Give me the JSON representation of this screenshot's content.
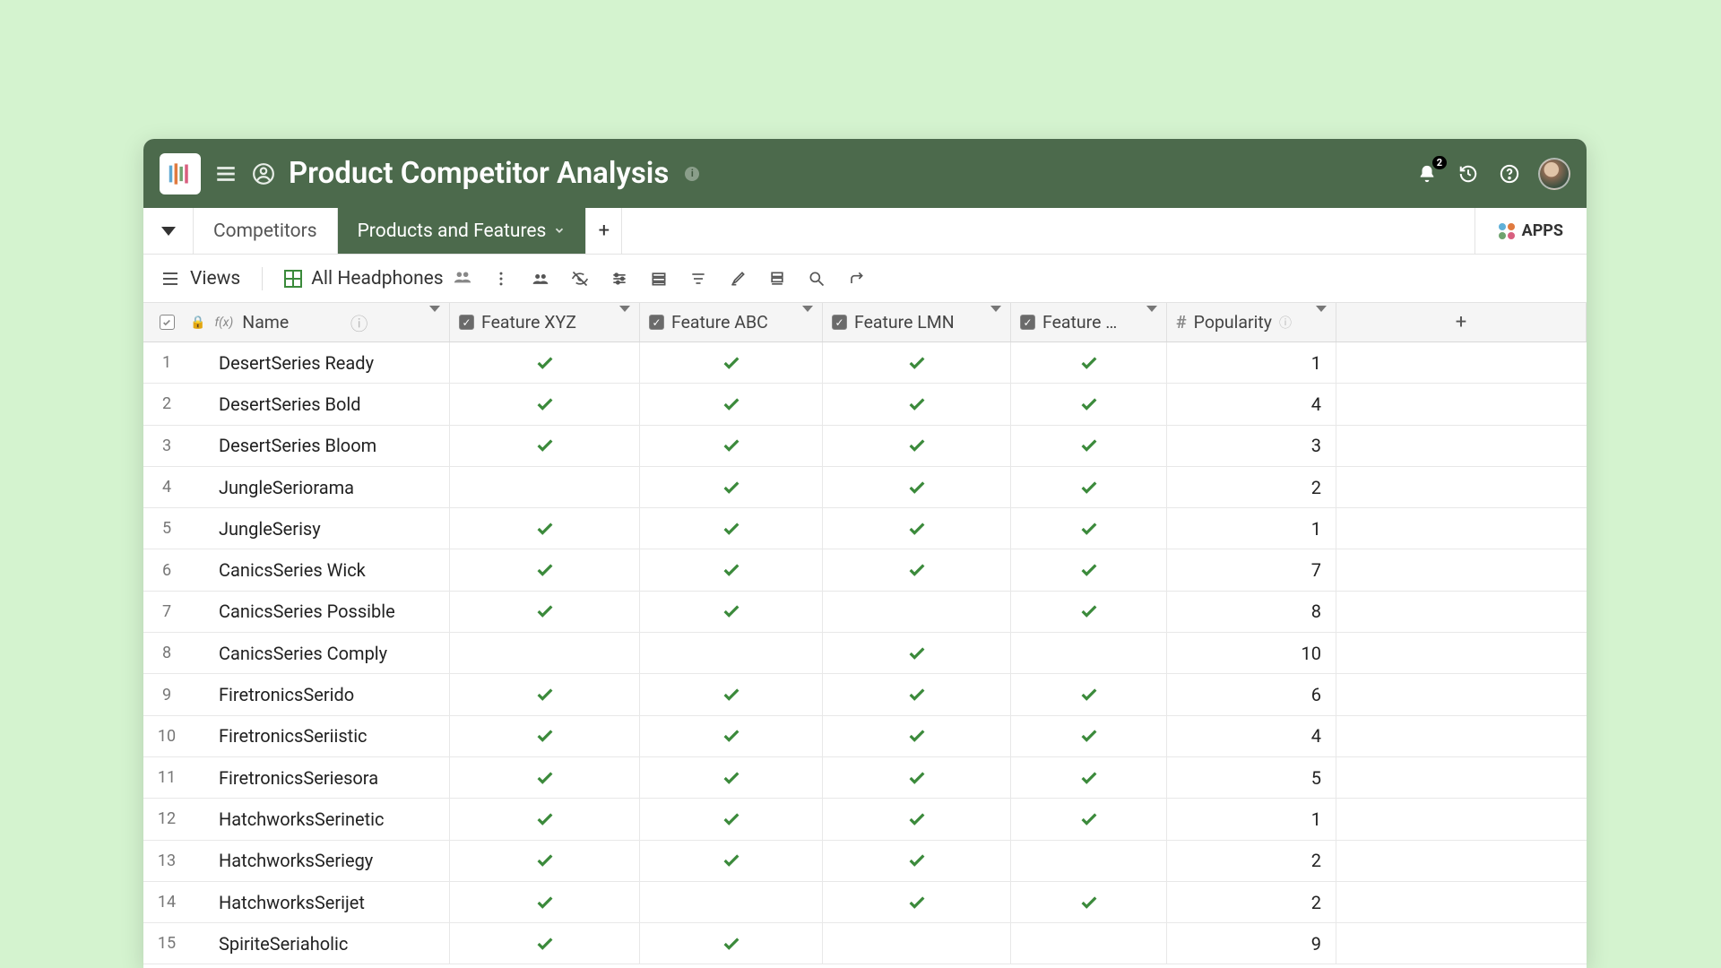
{
  "header": {
    "title": "Product Competitor Analysis",
    "notification_count": "2"
  },
  "tabs": {
    "items": [
      "Competitors",
      "Products and Features"
    ],
    "active_index": 1,
    "apps_label": "APPS"
  },
  "toolbar": {
    "views_label": "Views",
    "view_name": "All Headphones"
  },
  "columns": {
    "name": "Name",
    "feature_xyz": "Feature XYZ",
    "feature_abc": "Feature ABC",
    "feature_lmn": "Feature LMN",
    "feature_trunc": "Feature …",
    "popularity": "Popularity"
  },
  "rows": [
    {
      "n": "1",
      "name": "DesertSeries Ready",
      "xyz": true,
      "abc": true,
      "lmn": true,
      "f4": true,
      "pop": "1"
    },
    {
      "n": "2",
      "name": "DesertSeries Bold",
      "xyz": true,
      "abc": true,
      "lmn": true,
      "f4": true,
      "pop": "4"
    },
    {
      "n": "3",
      "name": "DesertSeries Bloom",
      "xyz": true,
      "abc": true,
      "lmn": true,
      "f4": true,
      "pop": "3"
    },
    {
      "n": "4",
      "name": "JungleSeriorama",
      "xyz": false,
      "abc": true,
      "lmn": true,
      "f4": true,
      "pop": "2"
    },
    {
      "n": "5",
      "name": "JungleSerisy",
      "xyz": true,
      "abc": true,
      "lmn": true,
      "f4": true,
      "pop": "1"
    },
    {
      "n": "6",
      "name": "CanicsSeries Wick",
      "xyz": true,
      "abc": true,
      "lmn": true,
      "f4": true,
      "pop": "7"
    },
    {
      "n": "7",
      "name": "CanicsSeries Possible",
      "xyz": true,
      "abc": true,
      "lmn": false,
      "f4": true,
      "pop": "8"
    },
    {
      "n": "8",
      "name": "CanicsSeries Comply",
      "xyz": false,
      "abc": false,
      "lmn": true,
      "f4": false,
      "pop": "10"
    },
    {
      "n": "9",
      "name": "FiretronicsSerido",
      "xyz": true,
      "abc": true,
      "lmn": true,
      "f4": true,
      "pop": "6"
    },
    {
      "n": "10",
      "name": "FiretronicsSeriistic",
      "xyz": true,
      "abc": true,
      "lmn": true,
      "f4": true,
      "pop": "4"
    },
    {
      "n": "11",
      "name": "FiretronicsSeriesora",
      "xyz": true,
      "abc": true,
      "lmn": true,
      "f4": true,
      "pop": "5"
    },
    {
      "n": "12",
      "name": "HatchworksSerinetic",
      "xyz": true,
      "abc": true,
      "lmn": true,
      "f4": true,
      "pop": "1"
    },
    {
      "n": "13",
      "name": "HatchworksSeriegy",
      "xyz": true,
      "abc": true,
      "lmn": true,
      "f4": false,
      "pop": "2"
    },
    {
      "n": "14",
      "name": "HatchworksSerijet",
      "xyz": true,
      "abc": false,
      "lmn": true,
      "f4": true,
      "pop": "2"
    },
    {
      "n": "15",
      "name": "SpiriteSeriaholic",
      "xyz": true,
      "abc": true,
      "lmn": false,
      "f4": false,
      "pop": "9"
    }
  ]
}
